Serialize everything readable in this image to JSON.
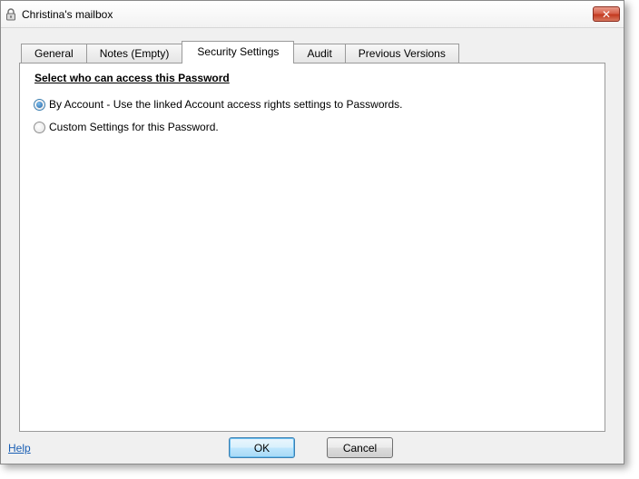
{
  "window": {
    "title": "Christina's mailbox",
    "close_label": "✕"
  },
  "tabs": [
    {
      "label": "General"
    },
    {
      "label": "Notes (Empty)"
    },
    {
      "label": "Security Settings",
      "active": true
    },
    {
      "label": "Audit"
    },
    {
      "label": "Previous Versions"
    }
  ],
  "security": {
    "heading": "Select who can access this Password",
    "options": [
      {
        "label": "By Account - Use the linked Account access rights settings to Passwords.",
        "checked": true
      },
      {
        "label": "Custom Settings for this Password.",
        "checked": false
      }
    ]
  },
  "footer": {
    "help_label": "Help",
    "ok_label": "OK",
    "cancel_label": "Cancel"
  },
  "colors": {
    "close_button": "#c33a20",
    "link": "#1a5fb4",
    "default_button_border": "#3c7fb1"
  }
}
